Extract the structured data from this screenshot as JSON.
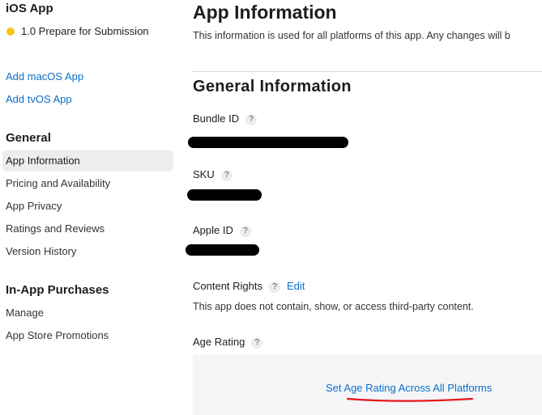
{
  "sidebar": {
    "app_title": "iOS App",
    "version_status": "1.0 Prepare for Submission",
    "status_color": "#f5c518",
    "add_links": [
      "Add macOS App",
      "Add tvOS App"
    ],
    "general_heading": "General",
    "general_items": [
      "App Information",
      "Pricing and Availability",
      "App Privacy",
      "Ratings and Reviews",
      "Version History"
    ],
    "active_item": "App Information",
    "iap_heading": "In-App Purchases",
    "iap_items": [
      "Manage",
      "App Store Promotions"
    ]
  },
  "main": {
    "title": "App Information",
    "description": "This information is used for all platforms of this app. Any changes will b",
    "section_title": "General Information",
    "fields": {
      "bundle_id_label": "Bundle ID",
      "sku_label": "SKU",
      "apple_id_label": "Apple ID",
      "content_rights_label": "Content Rights",
      "content_rights_edit": "Edit",
      "content_rights_value": "This app does not contain, show, or access third-party content.",
      "age_rating_label": "Age Rating",
      "age_rating_link": "Set Age Rating Across All Platforms"
    },
    "help_glyph": "?",
    "icons": [
      "status-dot-icon",
      "help-icon"
    ],
    "accent_color": "#0a6fcc",
    "annotation_color": "#e8161b"
  }
}
